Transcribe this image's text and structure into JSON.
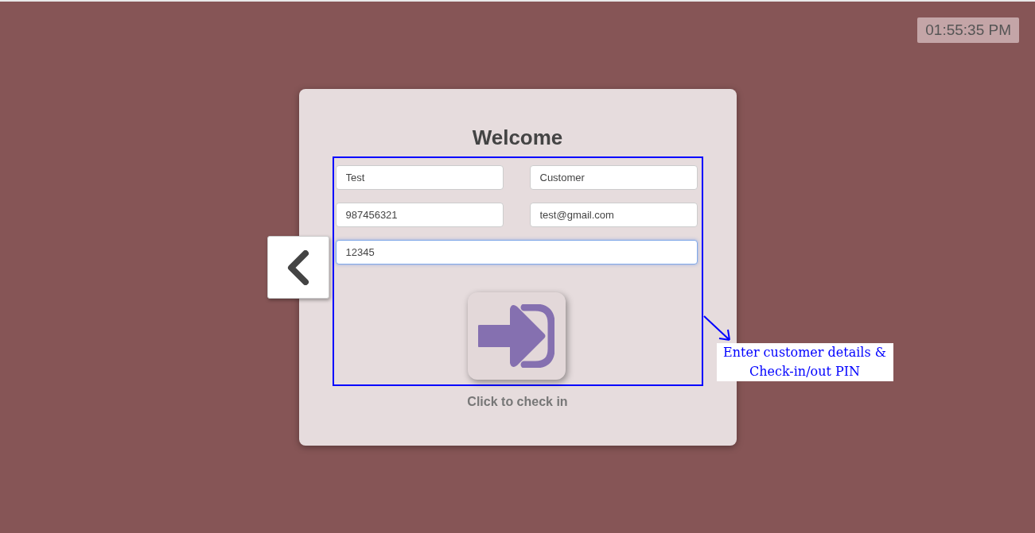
{
  "clock": "01:55:35 PM",
  "card": {
    "title": "Welcome",
    "fields": [
      {
        "value": "Test",
        "focused": false,
        "wide": false
      },
      {
        "value": "Customer",
        "focused": false,
        "wide": false
      },
      {
        "value": "987456321",
        "focused": false,
        "wide": false
      },
      {
        "value": "test@gmail.com",
        "focused": false,
        "wide": false
      },
      {
        "value": "12345",
        "focused": true,
        "wide": true
      }
    ],
    "caption": "Click to check in"
  },
  "annotation": {
    "text": "Enter customer details & Check-in/out PIN"
  }
}
